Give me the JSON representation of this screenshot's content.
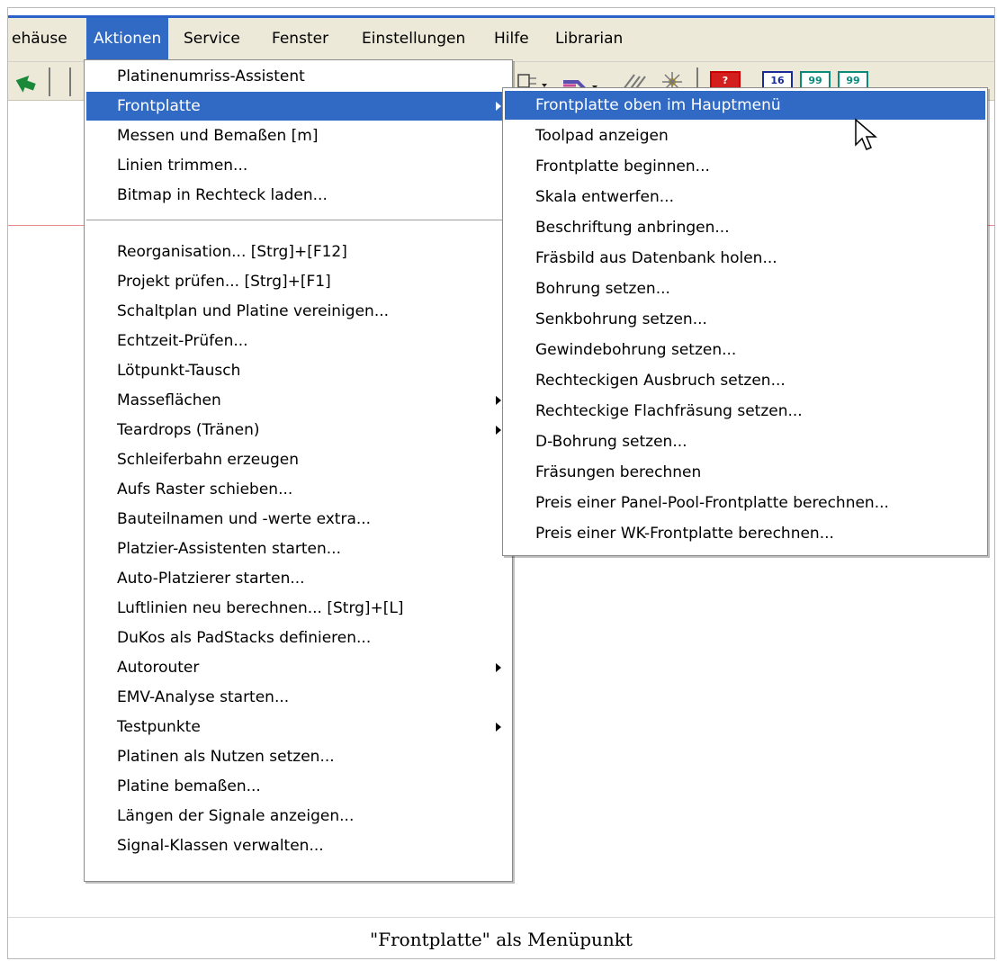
{
  "menubar": {
    "items": [
      {
        "label": "ehäuse"
      },
      {
        "label": "Aktionen"
      },
      {
        "label": "Service"
      },
      {
        "label": "Fenster"
      },
      {
        "label": "Einstellungen"
      },
      {
        "label": "Hilfe"
      },
      {
        "label": "Librarian"
      }
    ],
    "active_index": 1
  },
  "toolbar": {
    "boxes": [
      "?",
      "16",
      "99",
      "99"
    ]
  },
  "actions_menu": {
    "group1": [
      {
        "label": "Platinenumriss-Assistent"
      },
      {
        "label": "Frontplatte",
        "submenu": true,
        "highlighted": true
      },
      {
        "label": "Messen und Bemaßen    [m]"
      },
      {
        "label": "Linien trimmen..."
      },
      {
        "label": "Bitmap in Rechteck laden..."
      }
    ],
    "group2": [
      {
        "label": "Reorganisation...    [Strg]+[F12]"
      },
      {
        "label": "Projekt prüfen...    [Strg]+[F1]"
      },
      {
        "label": "Schaltplan und Platine vereinigen..."
      },
      {
        "label": "Echtzeit-Prüfen..."
      },
      {
        "label": "Lötpunkt-Tausch"
      },
      {
        "label": "Masseflächen",
        "submenu": true
      },
      {
        "label": "Teardrops (Tränen)",
        "submenu": true
      },
      {
        "label": "Schleiferbahn erzeugen"
      },
      {
        "label": "Aufs Raster schieben..."
      },
      {
        "label": "Bauteilnamen und -werte extra..."
      },
      {
        "label": "Platzier-Assistenten starten..."
      },
      {
        "label": "Auto-Platzierer starten..."
      },
      {
        "label": "Luftlinien neu berechnen...    [Strg]+[L]"
      },
      {
        "label": "DuKos als PadStacks definieren..."
      },
      {
        "label": "Autorouter",
        "submenu": true
      },
      {
        "label": "EMV-Analyse starten..."
      },
      {
        "label": "Testpunkte",
        "submenu": true
      },
      {
        "label": "Platinen als Nutzen setzen..."
      },
      {
        "label": "Platine bemaßen..."
      },
      {
        "label": "Längen der Signale anzeigen..."
      },
      {
        "label": "Signal-Klassen verwalten..."
      }
    ]
  },
  "frontplatte_submenu": {
    "items": [
      {
        "label": "Frontplatte oben im Hauptmenü",
        "highlighted": true
      },
      {
        "label": "Toolpad anzeigen"
      },
      {
        "label": "Frontplatte beginnen..."
      },
      {
        "label": "Skala entwerfen..."
      },
      {
        "label": "Beschriftung anbringen..."
      },
      {
        "label": "Fräsbild aus Datenbank holen..."
      },
      {
        "label": "Bohrung setzen..."
      },
      {
        "label": "Senkbohrung setzen..."
      },
      {
        "label": "Gewindebohrung setzen..."
      },
      {
        "label": "Rechteckigen Ausbruch setzen..."
      },
      {
        "label": "Rechteckige Flachfräsung setzen..."
      },
      {
        "label": "D-Bohrung setzen..."
      },
      {
        "label": "Fräsungen berechnen"
      },
      {
        "label": "Preis einer Panel-Pool-Frontplatte berechnen..."
      },
      {
        "label": "Preis einer WK-Frontplatte berechnen..."
      }
    ]
  },
  "caption": "\"Frontplatte\" als Menüpunkt",
  "colors": {
    "highlight": "#316ac5",
    "menubar_bg": "#ece9d8"
  }
}
